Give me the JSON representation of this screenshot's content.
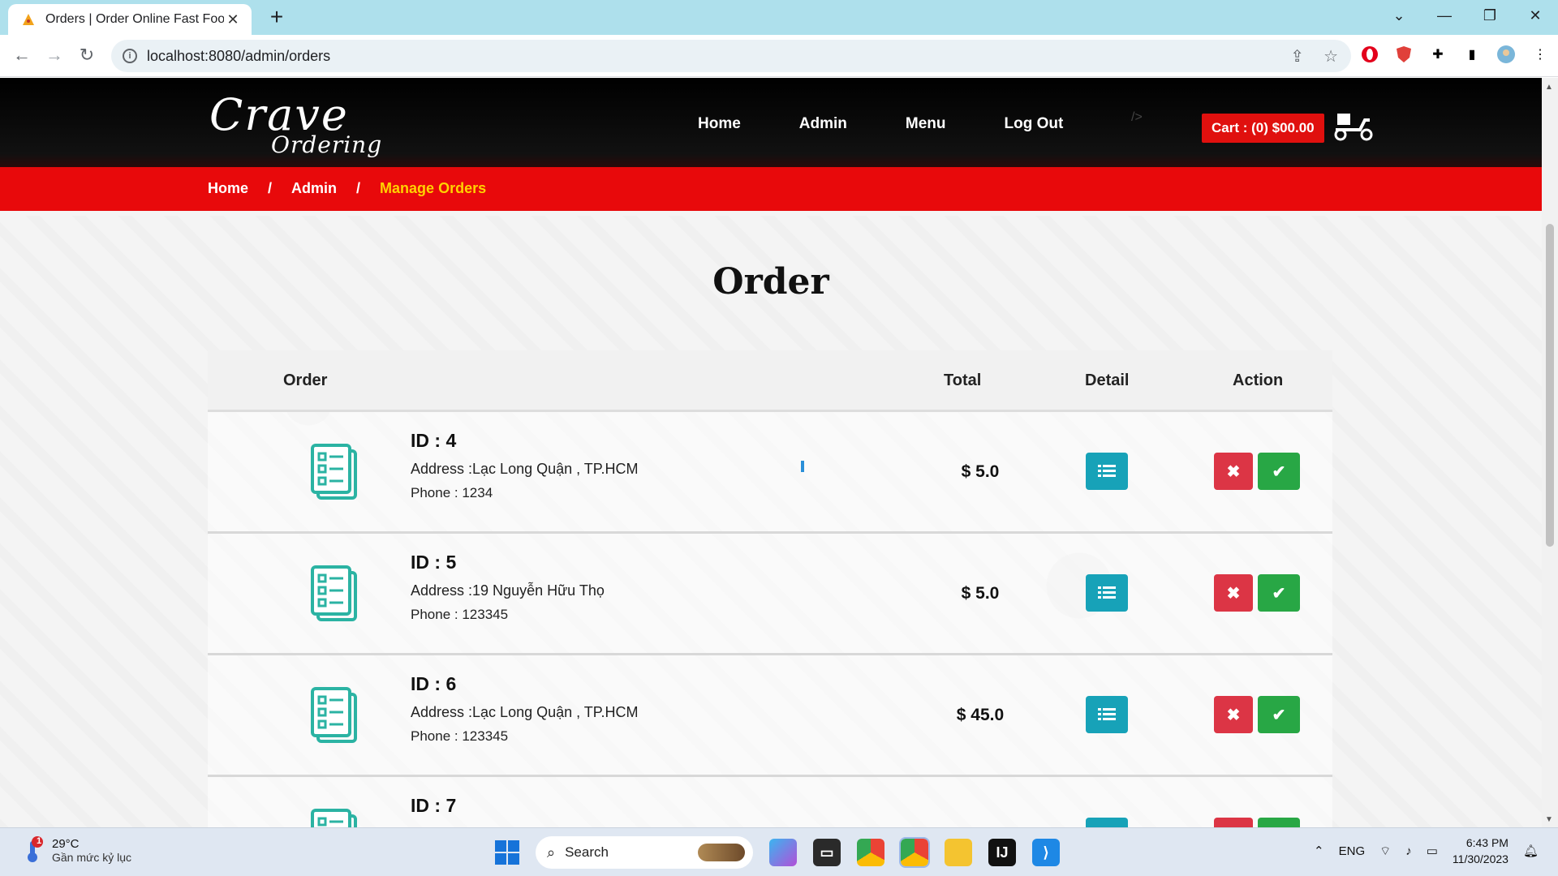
{
  "browser": {
    "tab_title": "Orders | Order Online Fast Food",
    "url": "localhost:8080/admin/orders"
  },
  "site": {
    "logo_line1": "Crave",
    "logo_line2": "Ordering",
    "nav": [
      "Home",
      "Admin",
      "Menu",
      "Log Out"
    ],
    "stray_text": "/>",
    "cart_label": "Cart : (0) $00.00"
  },
  "breadcrumb": {
    "items": [
      "Home",
      "Admin"
    ],
    "separator": "/",
    "current": "Manage Orders"
  },
  "page_title": "Order",
  "table": {
    "headers": {
      "order": "Order",
      "total": "Total",
      "detail": "Detail",
      "action": "Action"
    },
    "rows": [
      {
        "id": "ID : 4",
        "address": "Address :Lạc Long Quận , TP.HCM",
        "phone": "Phone : 1234",
        "total": "$ 5.0"
      },
      {
        "id": "ID : 5",
        "address": "Address :19 Nguyễn Hữu Thọ",
        "phone": "Phone : 123345",
        "total": "$ 5.0"
      },
      {
        "id": "ID : 6",
        "address": "Address :Lạc Long Quận , TP.HCM",
        "phone": "Phone : 123345",
        "total": "$ 45.0"
      },
      {
        "id": "ID : 7",
        "address": "",
        "phone": "",
        "total": ""
      }
    ]
  },
  "colors": {
    "brand_red": "#e8090b",
    "breadcrumb_current": "#ffd200",
    "detail_button": "#17a2b8",
    "delete_button": "#dc3545",
    "confirm_button": "#28a745",
    "order_icon": "#2bb3a3"
  },
  "taskbar": {
    "weather_temp": "29°C",
    "weather_desc": "Gần mức kỷ lục",
    "weather_badge": "1",
    "search_placeholder": "Search",
    "language": "ENG",
    "time": "6:43 PM",
    "date": "11/30/2023"
  }
}
